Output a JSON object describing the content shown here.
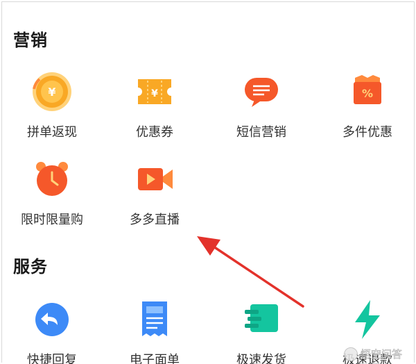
{
  "sections": {
    "marketing": {
      "title": "营销",
      "items": [
        {
          "label": "拼单返现",
          "icon": "yuan-coin-icon"
        },
        {
          "label": "优惠券",
          "icon": "coupon-ticket-icon"
        },
        {
          "label": "短信营销",
          "icon": "sms-chat-icon"
        },
        {
          "label": "多件优惠",
          "icon": "percent-tag-icon"
        },
        {
          "label": "限时限量购",
          "icon": "alarm-clock-icon"
        },
        {
          "label": "多多直播",
          "icon": "live-video-icon"
        }
      ]
    },
    "service": {
      "title": "服务",
      "items": [
        {
          "label": "快捷回复",
          "icon": "reply-bubble-icon"
        },
        {
          "label": "电子面单",
          "icon": "receipt-icon"
        },
        {
          "label": "极速发货",
          "icon": "fast-delivery-icon"
        },
        {
          "label": "极速退款",
          "icon": "lightning-icon"
        }
      ]
    }
  },
  "colors": {
    "orange": "#f5582a",
    "orange_light": "#ff8a3d",
    "yellow": "#f9a825",
    "blue": "#3d8af7",
    "teal": "#14c59f",
    "arrow_red": "#e3322b"
  },
  "watermark": {
    "text": "悟空问答",
    "icon": "wukong-logo-icon"
  }
}
